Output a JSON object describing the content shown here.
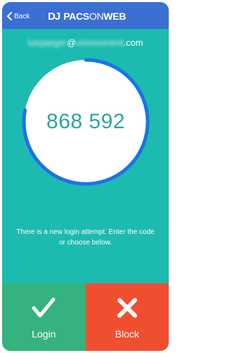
{
  "colors": {
    "background": "#1dbab0",
    "nav": "#3b6fd1",
    "ring_track": "#ffffff",
    "ring_progress": "#1a73e8",
    "code_text": "#2aa79d",
    "login_bg": "#36b27e",
    "block_bg": "#f04f2f"
  },
  "nav": {
    "back_label": "Back",
    "back_icon": "chevron-left-icon",
    "logo_mark": "DJ",
    "logo_text_a": "PACS",
    "logo_text_b": "ON",
    "logo_text_c": "WEB"
  },
  "account": {
    "email_user": "luisjaeger",
    "email_at": "@",
    "email_domain_blurred": "virinnoment",
    "email_tld": ".com"
  },
  "code": {
    "value": "868 592",
    "timer_remaining": 0.78
  },
  "prompt": {
    "message": "There is a new login attempt. Enter the code or choose below."
  },
  "actions": {
    "login_label": "Login",
    "login_icon": "checkmark-icon",
    "block_label": "Block",
    "block_icon": "x-icon"
  }
}
